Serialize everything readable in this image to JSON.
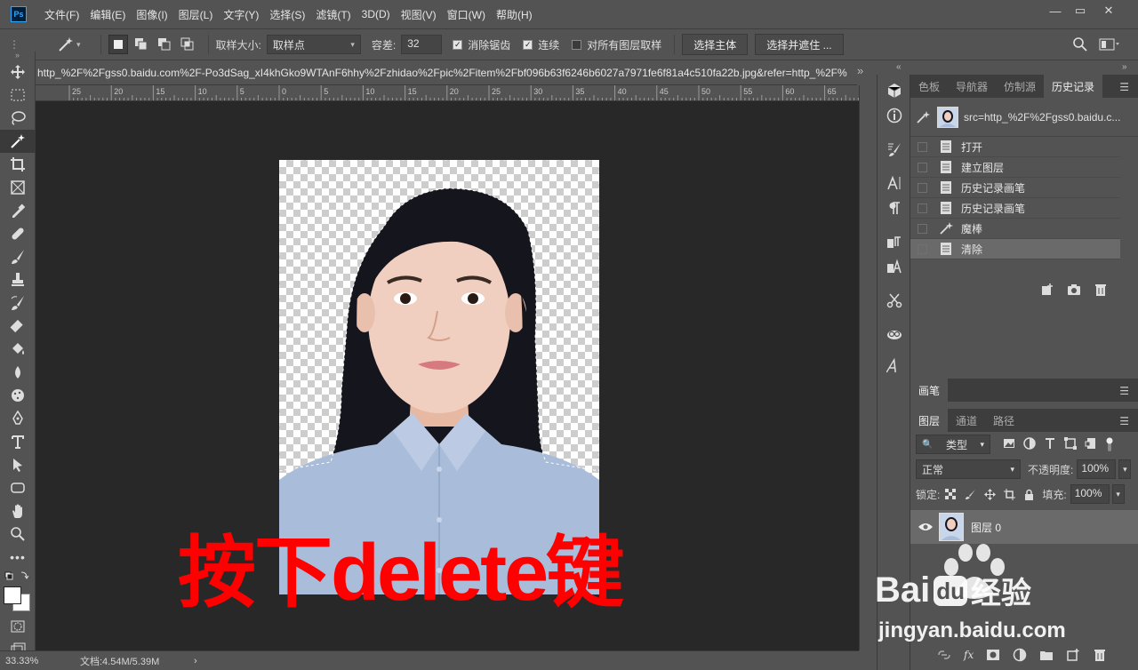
{
  "app": {
    "logo": "Ps"
  },
  "menu": [
    "文件(F)",
    "编辑(E)",
    "图像(I)",
    "图层(L)",
    "文字(Y)",
    "选择(S)",
    "滤镜(T)",
    "3D(D)",
    "视图(V)",
    "窗口(W)",
    "帮助(H)"
  ],
  "window_controls": {
    "minimize": "—",
    "restore": "▭",
    "close": "✕"
  },
  "options": {
    "sample_size_label": "取样大小:",
    "sample_size_value": "取样点",
    "tolerance_label": "容差:",
    "tolerance_value": "32",
    "antialias_label": "消除锯齿",
    "antialias_checked": true,
    "contiguous_label": "连续",
    "contiguous_checked": true,
    "sample_all_label": "对所有图层取样",
    "sample_all_checked": false,
    "select_subject": "选择主体",
    "select_mask": "选择并遮住 ..."
  },
  "document": {
    "tab_title": "http_%2F%2Fgss0.baidu.com%2F-Po3dSag_xI4khGko9WTAnF6hhy%2Fzhidao%2Fpic%2Fitem%2Fbf096b63f6246b6027a7971fe6f81a4c510fa22b.jpg&refer=http_%2F%",
    "ruler_marks": [
      "25",
      "20",
      "15",
      "10",
      "5",
      "0",
      "5",
      "10",
      "15",
      "20",
      "25",
      "30",
      "35",
      "40",
      "45",
      "50",
      "55",
      "60",
      "65"
    ],
    "overlay_cn1": "按下",
    "overlay_en": "delete",
    "overlay_cn2": "键"
  },
  "status": {
    "zoom": "33.33%",
    "doc_info": "文档:4.54M/5.39M",
    "arrow": "›"
  },
  "history_panel": {
    "tabs": [
      "色板",
      "导航器",
      "仿制源",
      "历史记录"
    ],
    "active_tab": 3,
    "snapshot_label": "src=http_%2F%2Fgss0.baidu.c...",
    "items": [
      {
        "label": "打开",
        "icon": "doc-icon"
      },
      {
        "label": "建立图层",
        "icon": "doc-icon"
      },
      {
        "label": "历史记录画笔",
        "icon": "doc-icon"
      },
      {
        "label": "历史记录画笔",
        "icon": "doc-icon"
      },
      {
        "label": "魔棒",
        "icon": "magic-wand-icon"
      },
      {
        "label": "清除",
        "icon": "doc-icon",
        "active": true
      }
    ]
  },
  "brush_panel": {
    "title": "画笔"
  },
  "layers_panel": {
    "tabs": [
      "图层",
      "通道",
      "路径"
    ],
    "filter_label": "类型",
    "blend_mode": "正常",
    "opacity_label": "不透明度:",
    "opacity_value": "100%",
    "lock_label": "锁定:",
    "fill_label": "填充:",
    "fill_value": "100%",
    "layers": [
      {
        "name": "图层 0",
        "visible": true
      }
    ]
  },
  "watermark": {
    "line1": "Bai",
    "du": "du",
    "line1b": "经验",
    "line2": "jingyan.baidu.com"
  },
  "colors": {
    "bg": "#535353",
    "canvas": "#282828",
    "overlay": "#ff0000",
    "active_row": "#6a6a6a"
  }
}
